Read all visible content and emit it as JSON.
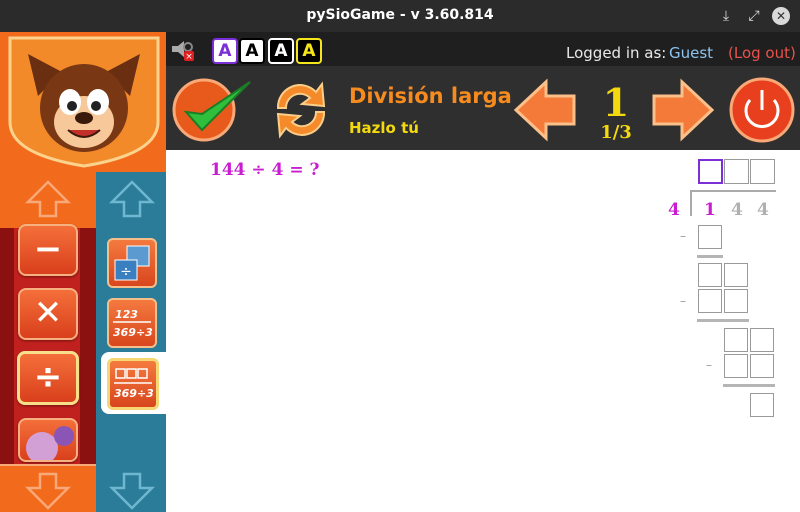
{
  "window": {
    "title": "pySioGame - v 3.60.814"
  },
  "topbar": {
    "font_options": [
      "A",
      "A",
      "A",
      "A"
    ],
    "logged_in_label": "Logged in as:",
    "user": "Guest",
    "logout": "(Log out)"
  },
  "game": {
    "title": "División larga",
    "subtitle": "Hazlo tú",
    "level": "1",
    "level_progress": "1/3"
  },
  "problem": {
    "equation": "144 ÷ 4 = ?",
    "divisor": "4",
    "dividend_digits": [
      "1",
      "4",
      "4"
    ]
  },
  "colors": {
    "orange": "#f26b1d",
    "teal": "#2a7c99",
    "title_orange": "#f68b1f",
    "level_yellow": "#f5d90f",
    "magenta": "#c81ed0",
    "violet": "#7b2fd6"
  },
  "sidebar": {
    "categories": [
      "minus-icon",
      "multiply-icon",
      "divide-icon",
      "fraction-pie-icon"
    ],
    "subgames": [
      "fraction-division-icon",
      "long-division-123-icon",
      "long-division-boxes-icon"
    ]
  }
}
